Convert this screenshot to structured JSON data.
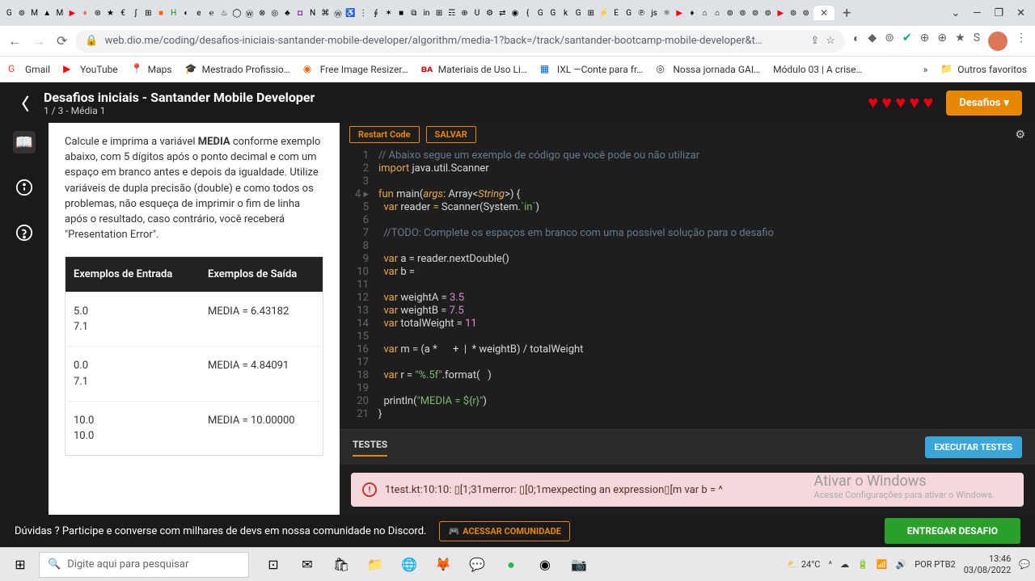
{
  "browser": {
    "url": "web.dio.me/coding/desafios-iniciais-santander-mobile-developer/algorithm/media-1?back=/track/santander-bootcamp-mobile-developer&t…",
    "new_tab_plus": "+",
    "close_tab": "✕",
    "window": {
      "min": "—",
      "max": "❐",
      "close": "✕",
      "down": "⌄"
    }
  },
  "bookmarks": {
    "b0": "Gmail",
    "b1": "YouTube",
    "b2": "Maps",
    "b3": "Mestrado Profissio…",
    "b4": "Free Image Resizer…",
    "b5": "Materiais de Uso Li…",
    "b6": "IXL —Conte para fr…",
    "b7": "Nossa jornada GAI…",
    "b8": "Módulo 03 | A crise…",
    "more": "»",
    "others": "Outros favoritos"
  },
  "header": {
    "title": "Desafios iniciais - Santander Mobile Developer",
    "subtitle": "1 / 3 - Média 1",
    "desafios": "Desafios"
  },
  "instructions": {
    "text_pre": "Calcule e imprima a variável ",
    "bold": "MEDIA",
    "text_post": " conforme exemplo abaixo, com 5 dígitos após o ponto decimal e com um espaço em branco antes e depois da igualdade. Utilize variáveis de dupla precisão (double) e como todos os problemas, não esqueça de imprimir o fim de linha após o resultado, caso contrário, você receberá \"Presentation Error\"."
  },
  "table": {
    "h1": "Exemplos de Entrada",
    "h2": "Exemplos de Saída",
    "r1c1": "5.0\n7.1",
    "r1c2": "MEDIA = 6.43182",
    "r2c1": "0.0\n7.1",
    "r2c2": "MEDIA = 4.84091",
    "r3c1": "10.0\n10.0",
    "r3c2": "MEDIA = 10.00000"
  },
  "toolbar": {
    "restart": "Restart Code",
    "salvar": "SALVAR"
  },
  "code": {
    "l1": "// Abaixo segue um exemplo de código que você pode ou não utilizar",
    "l2a": "import",
    "l2b": " java.util.Scanner",
    "l4_fun": "fun",
    "l4_main": " main(",
    "l4_args": "args",
    "l4_type": ": Array<",
    "l4_str": "String",
    "l4_end": ">) {",
    "l5_var": "var",
    "l5_reader": " reader ",
    "l5_eq": "=",
    "l5_scan": " Scanner(System.",
    "l5_in": "`in`",
    "l5_close": ")",
    "l7": "//TODO: Complete os espaços em branco com uma possível solução para o desafio",
    "l9_var": "var",
    "l9_a": " a ",
    "l9_call": "= reader.nextDouble()",
    "l10_var": "var",
    "l10_b": " b =",
    "l12_var": "var",
    "l12_wa": " weightA ",
    "l12_eq": "= ",
    "l12_v": "3.5",
    "l13_var": "var",
    "l13_wb": " weightB ",
    "l13_eq": "= ",
    "l13_v": "7.5",
    "l14_var": "var",
    "l14_tw": " totalWeight ",
    "l14_eq": "= ",
    "l14_v": "11",
    "l16_var": "var",
    "l16_m": " m = (a *      +  |  * weightB) / totalWeight",
    "l18_var": "var",
    "l18_r": " r = ",
    "l18_s": "\"%.5f\"",
    "l18_fmt": ".format(   )",
    "l20_pr": "println(",
    "l20_s": "\"MEDIA = ${r}\"",
    "l20_c": ")",
    "l21": "}"
  },
  "tests": {
    "label": "TESTES",
    "exec": "EXECUTAR TESTES"
  },
  "error": {
    "text": "1test.kt:10:10: ▯[1;31merror: ▯[0;1mexpecting an expression▯[m var b = ^"
  },
  "watermark": {
    "l1": "Ativar o Windows",
    "l2": "Acesse Configurações para ativar o Windows."
  },
  "footer": {
    "text": "Dúvidas ?  Participe e converse com milhares de devs em nossa comunidade no Discord.",
    "access": "ACESSAR COMUNIDADE",
    "submit": "ENTREGAR DESAFIO"
  },
  "taskbar": {
    "search_ph": "Digite aqui para pesquisar",
    "temp": "24°C",
    "lang": "POR PTB2",
    "time": "13:46",
    "date": "03/08/2022"
  }
}
